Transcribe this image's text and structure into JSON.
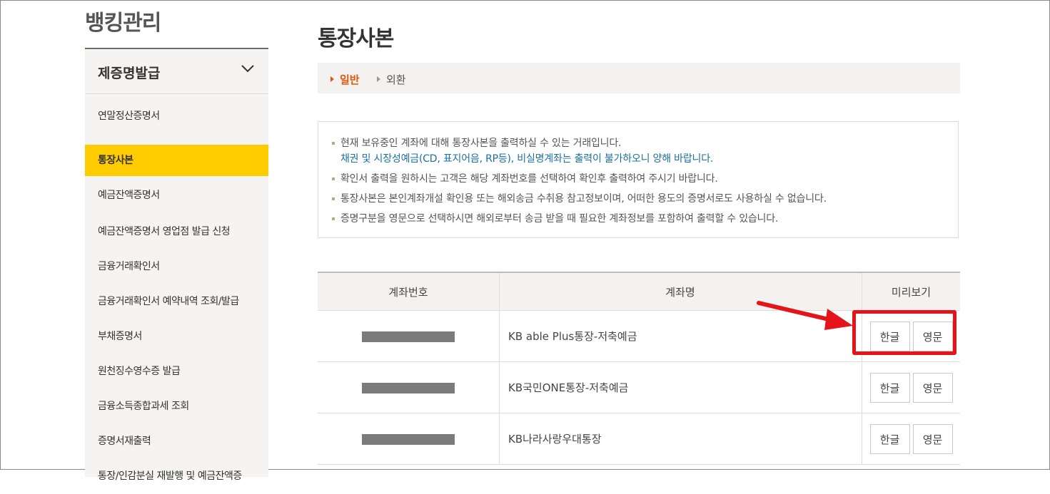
{
  "sidebar": {
    "title": "뱅킹관리",
    "section": "제증명발급",
    "items": [
      "연말정산증명서",
      "통장사본",
      "예금잔액증명서",
      "예금잔액증명서 영업점 발급 신청",
      "금융거래확인서",
      "금융거래확인서 예약내역 조회/발급",
      "부채증명서",
      "원천징수영수증 발급",
      "금융소득종합과세 조회",
      "증명서재출력",
      "통장/인감분실 재발행 및 예금잔액증"
    ],
    "active_index": 1
  },
  "page": {
    "title": "통장사본"
  },
  "tabs": {
    "general": "일반",
    "foreign": "외환"
  },
  "notice": {
    "line1": "현재 보유중인 계좌에 대해 통장사본을 출력하실 수 있는 거래입니다.",
    "line1_blue": "채권 및 시장성예금(CD, 표지어음, RP등), 비실명계좌는 출력이 불가하오니 양해 바랍니다.",
    "line2": "확인서 출력을 원하시는 고객은 해당 계좌번호를 선택하여 확인후 출력하여 주시기 바랍니다.",
    "line3": "통장사본은 본인계좌개설 확인용 또는 해외송금 수취용 참고정보이며, 어떠한 용도의 증명서로도 사용하실 수 없습니다.",
    "line4": "증명구분을 영문으로 선택하시면 해외로부터 송금 받을 때 필요한 계좌정보를 포함하여 출력할 수 있습니다."
  },
  "table": {
    "headers": {
      "account": "계좌번호",
      "name": "계좌명",
      "preview": "미리보기"
    },
    "rows": [
      {
        "name": "KB able Plus통장-저축예금",
        "btn_ko": "한글",
        "btn_en": "영문"
      },
      {
        "name": "KB국민ONE통장-저축예금",
        "btn_ko": "한글",
        "btn_en": "영문"
      },
      {
        "name": "KB나라사랑우대통장",
        "btn_ko": "한글",
        "btn_en": "영문"
      }
    ]
  },
  "colors": {
    "active_menu": "#ffcc00",
    "active_tab": "#e1560e",
    "notice_blue": "#1b6fa5",
    "annotation_red": "#e4141a"
  }
}
